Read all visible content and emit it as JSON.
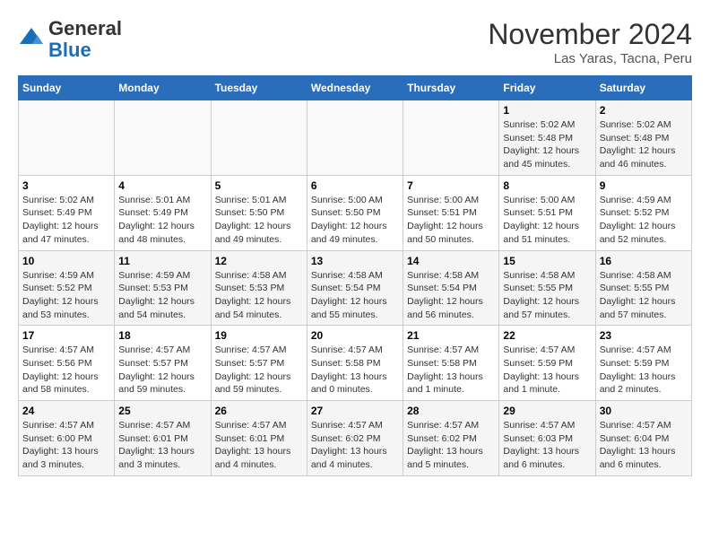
{
  "header": {
    "logo_line1": "General",
    "logo_line2": "Blue",
    "month": "November 2024",
    "location": "Las Yaras, Tacna, Peru"
  },
  "weekdays": [
    "Sunday",
    "Monday",
    "Tuesday",
    "Wednesday",
    "Thursday",
    "Friday",
    "Saturday"
  ],
  "weeks": [
    [
      {
        "day": "",
        "info": ""
      },
      {
        "day": "",
        "info": ""
      },
      {
        "day": "",
        "info": ""
      },
      {
        "day": "",
        "info": ""
      },
      {
        "day": "",
        "info": ""
      },
      {
        "day": "1",
        "info": "Sunrise: 5:02 AM\nSunset: 5:48 PM\nDaylight: 12 hours and 45 minutes."
      },
      {
        "day": "2",
        "info": "Sunrise: 5:02 AM\nSunset: 5:48 PM\nDaylight: 12 hours and 46 minutes."
      }
    ],
    [
      {
        "day": "3",
        "info": "Sunrise: 5:02 AM\nSunset: 5:49 PM\nDaylight: 12 hours and 47 minutes."
      },
      {
        "day": "4",
        "info": "Sunrise: 5:01 AM\nSunset: 5:49 PM\nDaylight: 12 hours and 48 minutes."
      },
      {
        "day": "5",
        "info": "Sunrise: 5:01 AM\nSunset: 5:50 PM\nDaylight: 12 hours and 49 minutes."
      },
      {
        "day": "6",
        "info": "Sunrise: 5:00 AM\nSunset: 5:50 PM\nDaylight: 12 hours and 49 minutes."
      },
      {
        "day": "7",
        "info": "Sunrise: 5:00 AM\nSunset: 5:51 PM\nDaylight: 12 hours and 50 minutes."
      },
      {
        "day": "8",
        "info": "Sunrise: 5:00 AM\nSunset: 5:51 PM\nDaylight: 12 hours and 51 minutes."
      },
      {
        "day": "9",
        "info": "Sunrise: 4:59 AM\nSunset: 5:52 PM\nDaylight: 12 hours and 52 minutes."
      }
    ],
    [
      {
        "day": "10",
        "info": "Sunrise: 4:59 AM\nSunset: 5:52 PM\nDaylight: 12 hours and 53 minutes."
      },
      {
        "day": "11",
        "info": "Sunrise: 4:59 AM\nSunset: 5:53 PM\nDaylight: 12 hours and 54 minutes."
      },
      {
        "day": "12",
        "info": "Sunrise: 4:58 AM\nSunset: 5:53 PM\nDaylight: 12 hours and 54 minutes."
      },
      {
        "day": "13",
        "info": "Sunrise: 4:58 AM\nSunset: 5:54 PM\nDaylight: 12 hours and 55 minutes."
      },
      {
        "day": "14",
        "info": "Sunrise: 4:58 AM\nSunset: 5:54 PM\nDaylight: 12 hours and 56 minutes."
      },
      {
        "day": "15",
        "info": "Sunrise: 4:58 AM\nSunset: 5:55 PM\nDaylight: 12 hours and 57 minutes."
      },
      {
        "day": "16",
        "info": "Sunrise: 4:58 AM\nSunset: 5:55 PM\nDaylight: 12 hours and 57 minutes."
      }
    ],
    [
      {
        "day": "17",
        "info": "Sunrise: 4:57 AM\nSunset: 5:56 PM\nDaylight: 12 hours and 58 minutes."
      },
      {
        "day": "18",
        "info": "Sunrise: 4:57 AM\nSunset: 5:57 PM\nDaylight: 12 hours and 59 minutes."
      },
      {
        "day": "19",
        "info": "Sunrise: 4:57 AM\nSunset: 5:57 PM\nDaylight: 12 hours and 59 minutes."
      },
      {
        "day": "20",
        "info": "Sunrise: 4:57 AM\nSunset: 5:58 PM\nDaylight: 13 hours and 0 minutes."
      },
      {
        "day": "21",
        "info": "Sunrise: 4:57 AM\nSunset: 5:58 PM\nDaylight: 13 hours and 1 minute."
      },
      {
        "day": "22",
        "info": "Sunrise: 4:57 AM\nSunset: 5:59 PM\nDaylight: 13 hours and 1 minute."
      },
      {
        "day": "23",
        "info": "Sunrise: 4:57 AM\nSunset: 5:59 PM\nDaylight: 13 hours and 2 minutes."
      }
    ],
    [
      {
        "day": "24",
        "info": "Sunrise: 4:57 AM\nSunset: 6:00 PM\nDaylight: 13 hours and 3 minutes."
      },
      {
        "day": "25",
        "info": "Sunrise: 4:57 AM\nSunset: 6:01 PM\nDaylight: 13 hours and 3 minutes."
      },
      {
        "day": "26",
        "info": "Sunrise: 4:57 AM\nSunset: 6:01 PM\nDaylight: 13 hours and 4 minutes."
      },
      {
        "day": "27",
        "info": "Sunrise: 4:57 AM\nSunset: 6:02 PM\nDaylight: 13 hours and 4 minutes."
      },
      {
        "day": "28",
        "info": "Sunrise: 4:57 AM\nSunset: 6:02 PM\nDaylight: 13 hours and 5 minutes."
      },
      {
        "day": "29",
        "info": "Sunrise: 4:57 AM\nSunset: 6:03 PM\nDaylight: 13 hours and 6 minutes."
      },
      {
        "day": "30",
        "info": "Sunrise: 4:57 AM\nSunset: 6:04 PM\nDaylight: 13 hours and 6 minutes."
      }
    ]
  ]
}
